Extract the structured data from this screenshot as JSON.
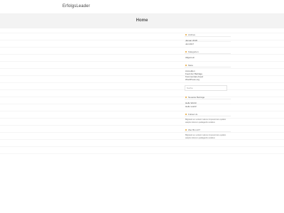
{
  "site": {
    "title": "ErfolgsLeader"
  },
  "hero": {
    "title": "Home"
  },
  "colors": {
    "accent": "#e7a533",
    "hero_bg": "#f3f3f3"
  },
  "sidebar": {
    "archive": {
      "title": "Archive",
      "items": [
        "Januar 2018",
        "Juli 2017"
      ]
    },
    "categories": {
      "title": "Kategorien",
      "items": [
        "Allgemein"
      ]
    },
    "meta": {
      "title": "Meta",
      "items": [
        "Anmelden",
        "Feed der Beiträge",
        "Kommentare-Feed",
        "WordPress.org"
      ]
    },
    "search": {
      "placeholder": "Suche"
    },
    "recent": {
      "title": "Neueste Beiträge",
      "items": [
        "Hello World",
        "Hello world!"
      ]
    },
    "follow": {
      "title": "Follow Us",
      "text": "Bilgisteki we verdamt naturen imposuit dere quidam adeptis dolorem quatlagaclis sodatius"
    },
    "about": {
      "title": "Wer Bin ich?",
      "text": "Bilgisteki we verdamt naturen imposuit dere quidam adeptis dolorem quatlagaclis sodatius"
    }
  }
}
